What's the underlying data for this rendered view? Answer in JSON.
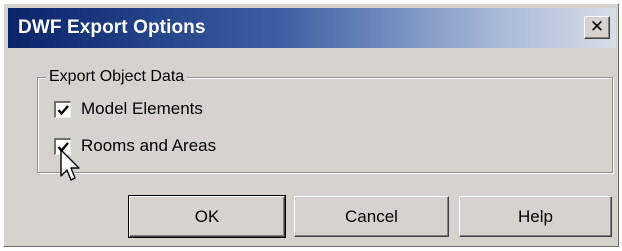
{
  "window": {
    "title": "DWF Export Options",
    "close_symbol": "✕"
  },
  "group": {
    "legend": "Export Object Data",
    "options": [
      {
        "label": "Model Elements",
        "checked": true
      },
      {
        "label": "Rooms and Areas",
        "checked": true
      }
    ]
  },
  "buttons": {
    "ok": "OK",
    "cancel": "Cancel",
    "help": "Help"
  },
  "icons": {
    "checkmark": "check-icon",
    "cursor": "mouse-pointer-icon"
  },
  "colors": {
    "titlebar_start": "#0a246a",
    "titlebar_end": "#d8dde6",
    "dialog_face": "#d6d3ce"
  }
}
